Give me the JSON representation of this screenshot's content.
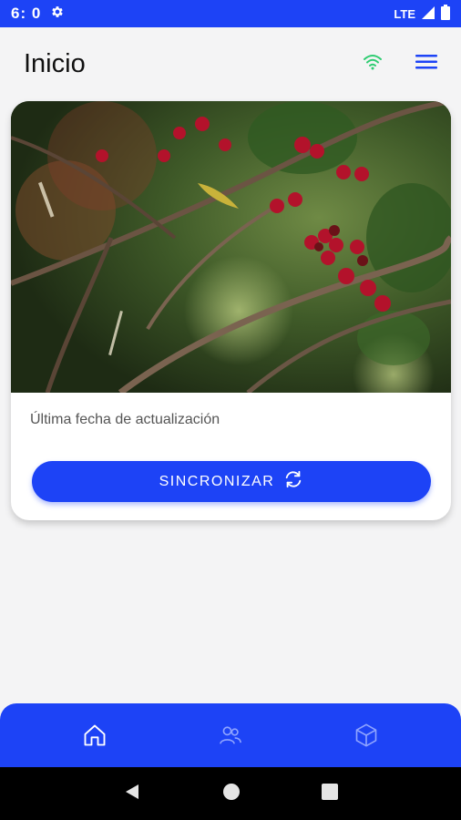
{
  "status_bar": {
    "time": "6: 0",
    "network": "LTE",
    "icons": [
      "settings-icon",
      "signal-icon",
      "battery-icon"
    ]
  },
  "header": {
    "title": "Inicio",
    "icons": [
      "wifi-icon",
      "menu-icon"
    ]
  },
  "card": {
    "image": "coffee-cherries-photo",
    "last_update_label": "Última fecha de actualización",
    "sync_button_label": "SINCRONIZAR",
    "sync_icon": "sync-icon"
  },
  "bottom_nav": {
    "items": [
      "home-icon",
      "users-icon",
      "cube-icon"
    ]
  },
  "system_nav": {
    "items": [
      "back-icon",
      "home-circle-icon",
      "recents-icon"
    ]
  },
  "colors": {
    "primary": "#1d43f6",
    "wifi": "#2ecc71",
    "background": "#f4f4f5"
  }
}
